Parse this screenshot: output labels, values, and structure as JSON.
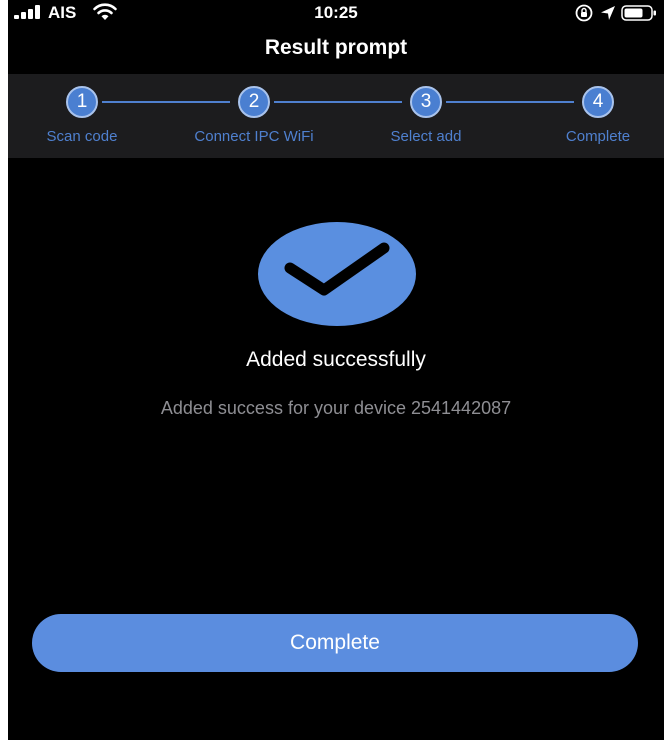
{
  "status_bar": {
    "carrier": "AIS",
    "time": "10:25",
    "icons": [
      "signal-icon",
      "wifi-icon",
      "lock-rotation-icon",
      "location-icon",
      "battery-icon"
    ]
  },
  "header": {
    "title": "Result prompt"
  },
  "stepper": {
    "steps": [
      {
        "number": "1",
        "label": "Scan code"
      },
      {
        "number": "2",
        "label": "Connect IPC WiFi"
      },
      {
        "number": "3",
        "label": "Select add"
      },
      {
        "number": "4",
        "label": "Complete"
      }
    ]
  },
  "result": {
    "icon": "checkmark-icon",
    "title": "Added successfully",
    "message": "Added success for your device 2541442087"
  },
  "actions": {
    "complete_label": "Complete"
  },
  "colors": {
    "background": "#000000",
    "stepper_bg": "#1c1c1e",
    "accent": "#5b8ddf",
    "step_label": "#4f80cf",
    "secondary_text": "#8e8e93"
  }
}
